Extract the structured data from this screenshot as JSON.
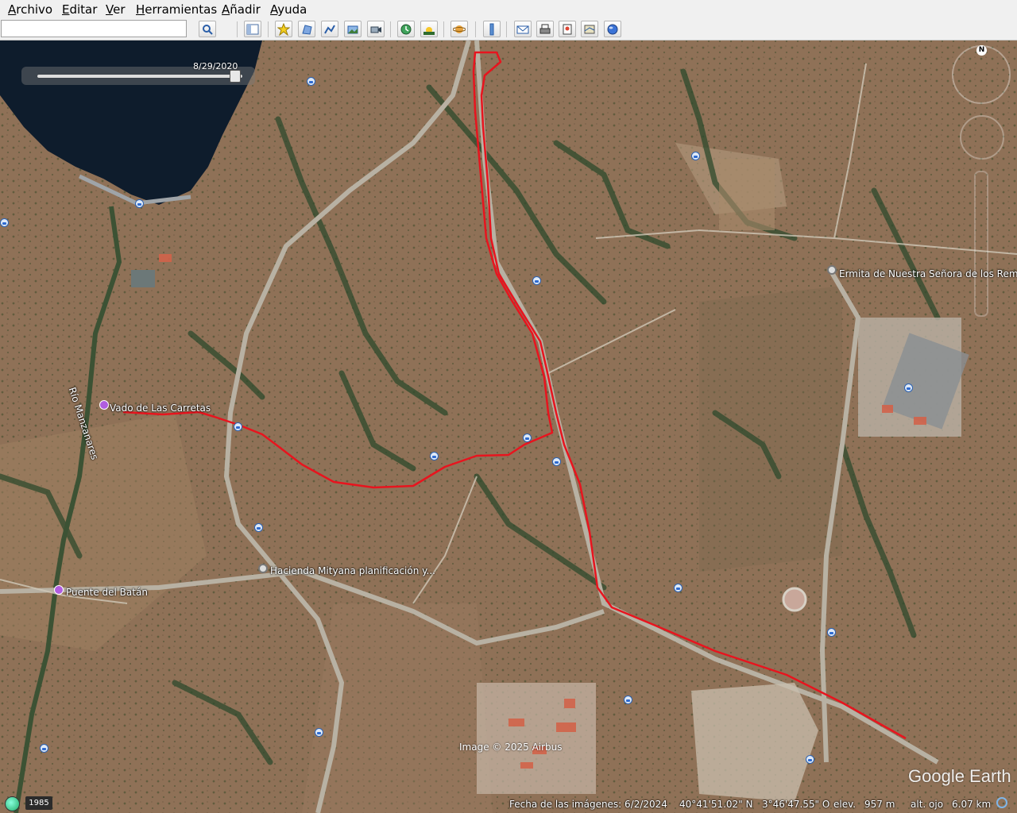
{
  "menu": [
    "Archivo",
    "Editar",
    "Ver",
    "Herramientas",
    "Añadir",
    "Ayuda"
  ],
  "search": {
    "value": ""
  },
  "toolbar": {
    "icons": [
      "search-icon",
      "sidebar-toggle-icon",
      "placemark-icon",
      "polygon-icon",
      "path-icon",
      "image-overlay-icon",
      "record-tour-icon",
      "historical-imagery-icon",
      "sunlight-icon",
      "switch-planet-icon",
      "ruler-icon",
      "email-icon",
      "print-icon",
      "save-image-icon",
      "view-in-maps-icon",
      "gallery-icon"
    ]
  },
  "timeline": {
    "date": "8/29/2020"
  },
  "places": {
    "vado": "Vado de Las Carretas",
    "puente": "Puente del Batán",
    "hacienda": "Hacienda Mityana planificación y...",
    "ermita": "Ermita de Nuestra Señora de los Rem",
    "rio": "Río Manzanares"
  },
  "map": {
    "route_color": "#e8141e",
    "compass_label": "N"
  },
  "credit": "Image © 2025 Airbus",
  "logo": "Google Earth",
  "status": {
    "year": "1985",
    "imagery_date": "Fecha de las imágenes: 6/2/2024",
    "lat": "40°41'51.02\" N",
    "lon": "3°46'47.55\" O",
    "elev_label": "elev.",
    "elev": "957 m",
    "eye_label": "alt. ojo",
    "eye": "6.07 km"
  }
}
